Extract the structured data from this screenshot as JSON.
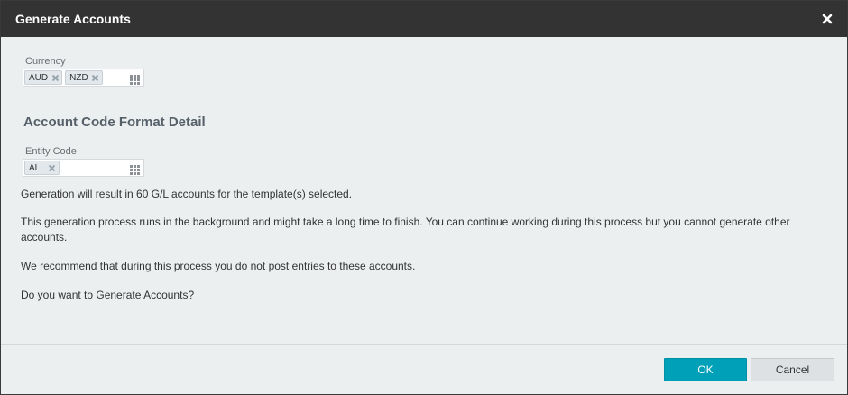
{
  "dialog": {
    "title": "Generate Accounts",
    "close_icon": "close-icon"
  },
  "currency": {
    "label": "Currency",
    "tags": [
      "AUD",
      "NZD"
    ]
  },
  "section": {
    "heading": "Account Code Format Detail"
  },
  "entity_code": {
    "label": "Entity Code",
    "tags": [
      "ALL"
    ]
  },
  "messages": {
    "line1": "Generation will result in 60 G/L accounts for the template(s) selected.",
    "line2": "This generation process runs in the background and might take a long time to finish. You can continue working during this process but you cannot generate other accounts.",
    "line3": "We recommend that during this process you do not post entries to these accounts.",
    "line4": "Do you want to Generate Accounts?"
  },
  "footer": {
    "ok_label": "OK",
    "cancel_label": "Cancel"
  },
  "colors": {
    "titlebar": "#333333",
    "primary_button": "#00a0b8",
    "background": "#eceff0"
  }
}
